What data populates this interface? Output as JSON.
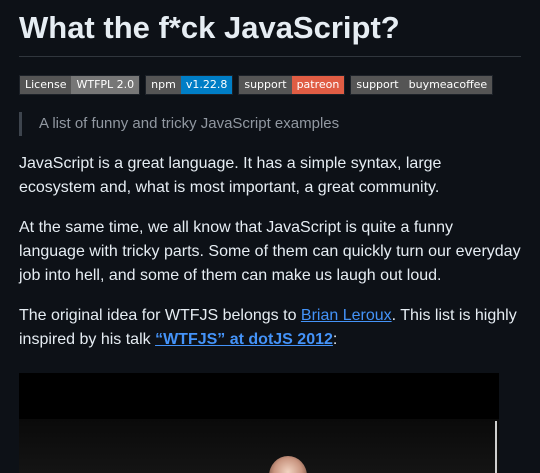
{
  "title": "What the f*ck JavaScript?",
  "badges": [
    {
      "label": "License",
      "value": "WTFPL 2.0",
      "color": "#777777"
    },
    {
      "label": "npm",
      "value": "v1.22.8",
      "color": "#007ec6"
    },
    {
      "label": "support",
      "value": "patreon",
      "color": "#e05d44"
    },
    {
      "label": "support",
      "value": "buymeacoffee",
      "color": "#555555"
    }
  ],
  "blockquote": "A list of funny and tricky JavaScript examples",
  "paragraphs": {
    "p1": "JavaScript is a great language. It has a simple syntax, large ecosystem and, what is most important, a great community.",
    "p2": "At the same time, we all know that JavaScript is quite a funny language with tricky parts. Some of them can quickly turn our everyday job into hell, and some of them can make us laugh out loud.",
    "p3_before": "The original idea for WTFJS belongs to ",
    "p3_link1": "Brian Leroux",
    "p3_middle": ". This list is highly inspired by his talk ",
    "p3_link2": "“WTFJS” at dotJS 2012",
    "p3_end": ":"
  }
}
